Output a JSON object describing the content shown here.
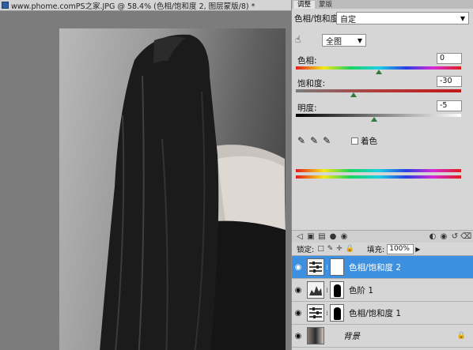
{
  "document": {
    "title": "www.phome.comPS之家.JPG @ 58.4% (色相/饱和度 2, 图层蒙版/8) *"
  },
  "adjustments_panel": {
    "tabs": [
      "调整",
      "蒙版"
    ],
    "title": "色相/饱和度",
    "preset": "自定",
    "edit_range": "全图",
    "hue": {
      "label": "色相:",
      "value": "0",
      "fraction": 0.5
    },
    "saturation": {
      "label": "饱和度:",
      "value": "-30",
      "fraction": 0.35
    },
    "lightness": {
      "label": "明度:",
      "value": "-5",
      "fraction": 0.475
    },
    "colorize_label": "着色",
    "colors": {
      "thumb": "#2e7a3f",
      "selected_row": "#3d8fdf"
    }
  },
  "layers_panel": {
    "lock_label": "锁定:",
    "fill_label": "填充:",
    "fill_value": "100%",
    "layers": [
      {
        "name": "色相/饱和度 2",
        "selected": true
      },
      {
        "name": "色阶 1",
        "selected": false
      },
      {
        "name": "色相/饱和度 1",
        "selected": false
      },
      {
        "name": "背景",
        "selected": false
      }
    ]
  }
}
